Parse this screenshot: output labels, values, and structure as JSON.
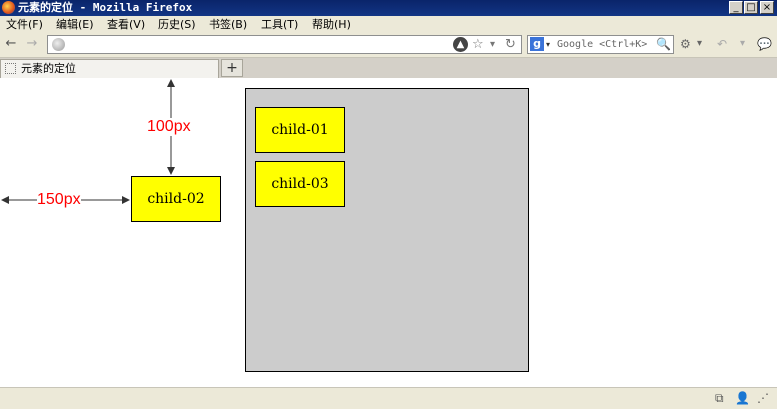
{
  "window": {
    "title": "元素的定位 - Mozilla Firefox",
    "minimize": "_",
    "maximize": "□",
    "close": "×"
  },
  "menu": [
    {
      "label": "文件(F)"
    },
    {
      "label": "编辑(E)"
    },
    {
      "label": "查看(V)"
    },
    {
      "label": "历史(S)"
    },
    {
      "label": "书签(B)"
    },
    {
      "label": "工具(T)"
    },
    {
      "label": "帮助(H)"
    }
  ],
  "nav": {
    "back": "←",
    "forward": "→",
    "url": "",
    "go": "▲",
    "bookmark_star": "☆",
    "dropdown": "▾",
    "reload": "↻",
    "search_engine": "g",
    "search_dropdown": "▾",
    "search_placeholder": "Google <Ctrl+K>",
    "search_go": "🔍",
    "tools_icon": "⚙",
    "tools_dropdown": "▾",
    "undo": "↶",
    "undo_dropdown": "▾",
    "chat": "💬"
  },
  "tabs": [
    {
      "label": "元素的定位"
    }
  ],
  "new_tab": "+",
  "page": {
    "children": [
      "child-01",
      "child-03"
    ],
    "positioned_child": "child-02",
    "top_offset_label": "100px",
    "left_offset_label": "150px"
  },
  "status": {
    "icon1": "⧉",
    "icon2": "👤",
    "grip": "⋰"
  },
  "colors": {
    "child_bg": "#ffff00",
    "parent_bg": "#cccccc",
    "annotation": "#ff0000",
    "titlebar": "#0a246a",
    "chrome": "#ece9d8"
  }
}
